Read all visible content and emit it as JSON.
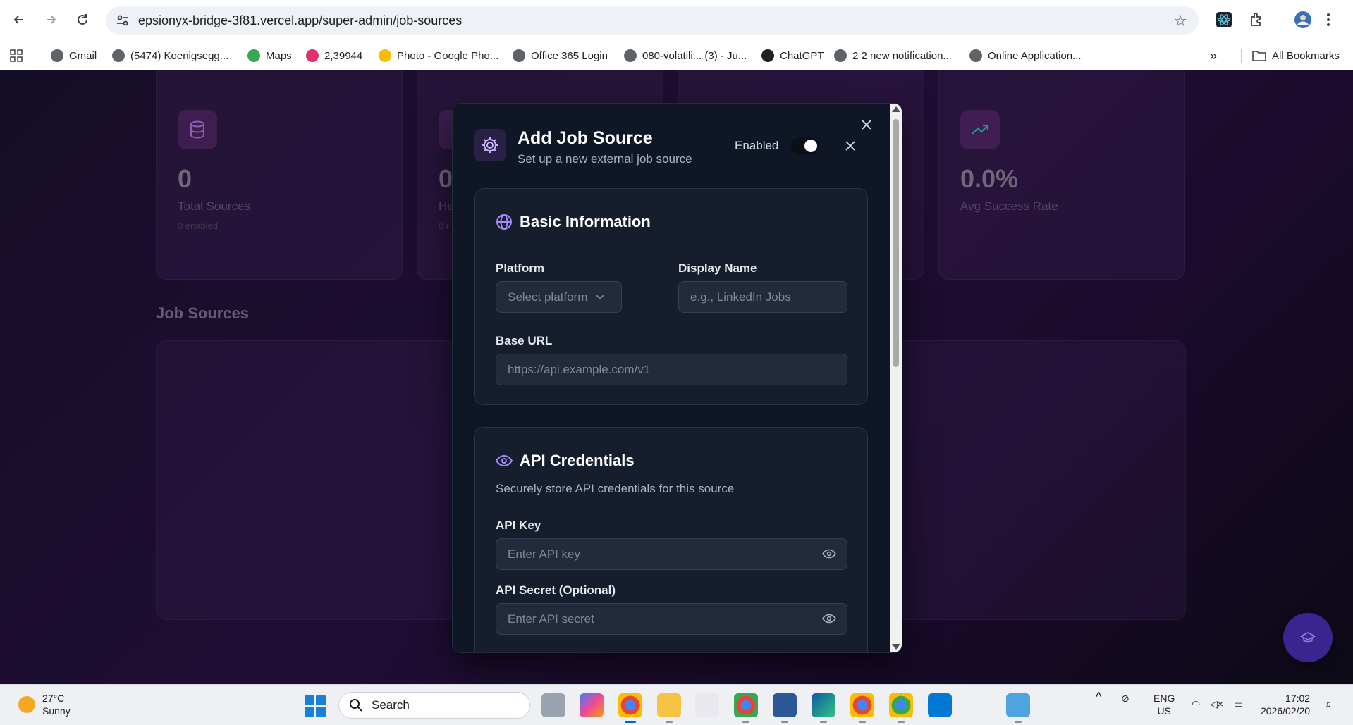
{
  "browser": {
    "url": "epsionyx-bridge-3f81.vercel.app/super-admin/job-sources",
    "bookmarks": [
      {
        "label": "Gmail",
        "icon": "globe-icon",
        "color": "#5f6368"
      },
      {
        "label": "(5474) Koenigsegg...",
        "icon": "globe-icon",
        "color": "#5f6368"
      },
      {
        "label": "Maps",
        "icon": "maps-pin-icon",
        "color": "#34a853"
      },
      {
        "label": "2,39944",
        "icon": "instagram-icon",
        "color": "#e1306c"
      },
      {
        "label": "Photo - Google Pho...",
        "icon": "google-photos-icon",
        "color": "#fbbc05"
      },
      {
        "label": "Office 365 Login",
        "icon": "globe-icon",
        "color": "#5f6368"
      },
      {
        "label": "080-volatili... (3) - Ju...",
        "icon": "globe-icon",
        "color": "#5f6368"
      },
      {
        "label": "ChatGPT",
        "icon": "chatgpt-icon",
        "color": "#202124"
      },
      {
        "label": "2 2 new notification...",
        "icon": "globe-icon",
        "color": "#5f6368"
      },
      {
        "label": "Online Application...",
        "icon": "globe-icon",
        "color": "#5f6368"
      }
    ],
    "all_bookmarks": "All Bookmarks"
  },
  "stats": [
    {
      "value": "0",
      "label": "Total Sources",
      "sub": "0 enabled",
      "icon": "database-icon"
    },
    {
      "value": "0",
      "label": "He",
      "sub": "0 r",
      "icon": "heart-icon"
    },
    {
      "value": "",
      "label": "",
      "sub": "",
      "icon": ""
    },
    {
      "value": "0.0%",
      "label": "Avg Success Rate",
      "sub": "",
      "icon": "trending-up-icon"
    }
  ],
  "section": {
    "title": "Job Sources"
  },
  "modal": {
    "title": "Add Job Source",
    "subtitle": "Set up a new external job source",
    "enabled_label": "Enabled",
    "enabled": true,
    "basic": {
      "title": "Basic Information",
      "platform_label": "Platform",
      "platform_value": "Select platform",
      "display_name_label": "Display Name",
      "display_name_placeholder": "e.g., LinkedIn Jobs",
      "base_url_label": "Base URL",
      "base_url_placeholder": "https://api.example.com/v1"
    },
    "api": {
      "title": "API Credentials",
      "description": "Securely store API credentials for this source",
      "key_label": "API Key",
      "key_placeholder": "Enter API key",
      "secret_label": "API Secret (Optional)",
      "secret_placeholder": "Enter API secret"
    }
  },
  "taskbar": {
    "temp": "27°C",
    "condition": "Sunny",
    "search_label": "Search",
    "lang": "ENG",
    "region": "US",
    "time": "17:02",
    "date": "2026/02/20"
  },
  "colors": {
    "accent": "#a78bfa",
    "stat_icon": "#c084fc",
    "trend_icon": "#2dd4bf"
  }
}
